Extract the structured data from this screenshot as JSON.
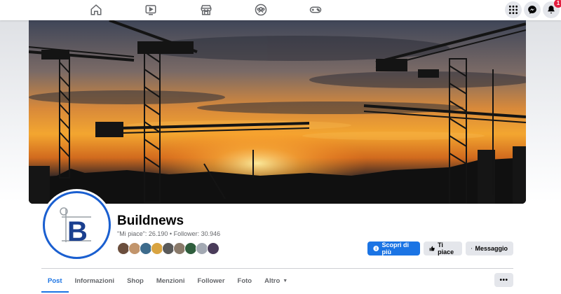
{
  "topnav": {
    "icons": [
      "home-icon",
      "video-icon",
      "marketplace-icon",
      "groups-icon",
      "gaming-icon"
    ],
    "right_icons": [
      "menu-grid-icon",
      "messenger-icon",
      "notifications-icon"
    ],
    "notification_count": "1"
  },
  "page": {
    "name": "Buildnews",
    "stats": "\"Mi piace\": 26.190 • Follower: 30.946",
    "logo_letter": "B"
  },
  "actions": {
    "primary": "Scopri di più",
    "like": "Ti piace",
    "message": "Messaggio"
  },
  "tabs": [
    {
      "label": "Post",
      "active": true
    },
    {
      "label": "Informazioni",
      "active": false
    },
    {
      "label": "Shop",
      "active": false
    },
    {
      "label": "Menzioni",
      "active": false
    },
    {
      "label": "Follower",
      "active": false
    },
    {
      "label": "Foto",
      "active": false
    },
    {
      "label": "Altro",
      "active": false
    }
  ],
  "more_button": "•••",
  "colors": {
    "accent": "#1b74e4",
    "badge": "#e41e3f",
    "brand_blue": "#1a5fd0"
  }
}
